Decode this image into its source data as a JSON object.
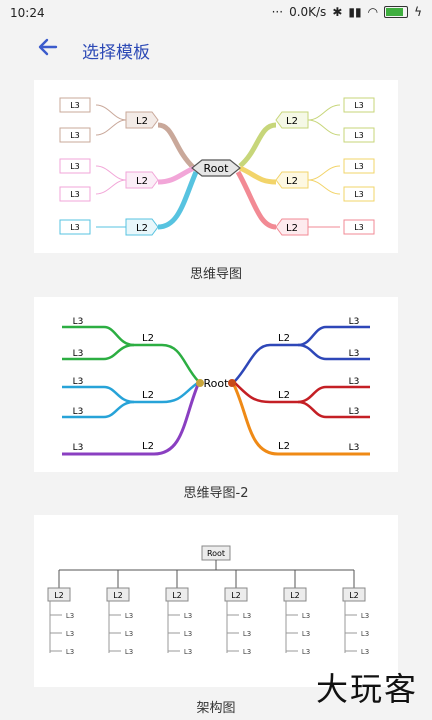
{
  "status": {
    "time": "10:24",
    "speed": "0.0K/s",
    "battery_level": 0.85
  },
  "toolbar": {
    "title": "选择模板"
  },
  "templates": [
    {
      "caption": "思维导图"
    },
    {
      "caption": "思维导图-2"
    },
    {
      "caption": "架构图"
    }
  ],
  "labels": {
    "root": "Root",
    "l2": "L2",
    "l3": "L3"
  },
  "watermark": "大玩客"
}
